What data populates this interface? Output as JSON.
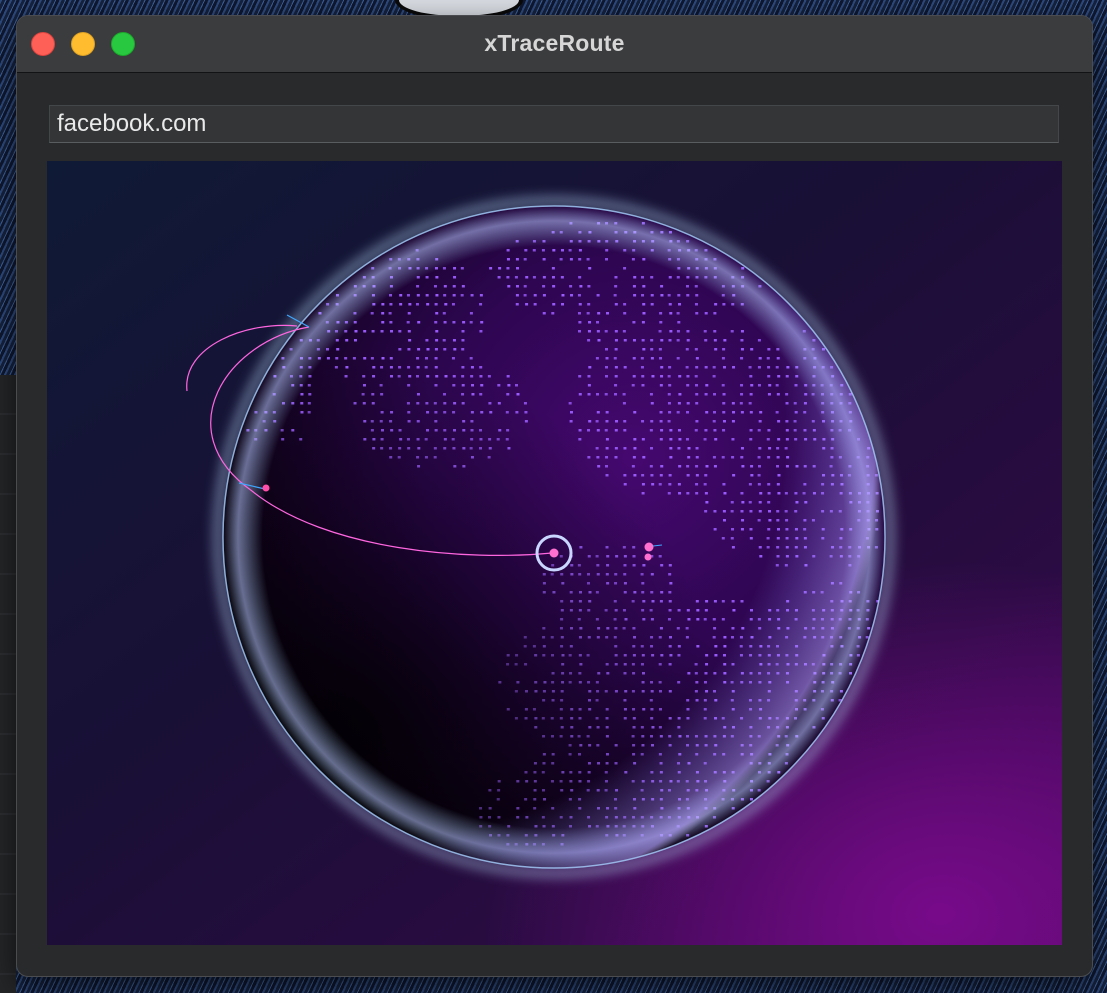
{
  "window": {
    "title": "xTraceRoute"
  },
  "controls": {
    "close": "close-button",
    "minimize": "minimize-button",
    "zoom": "zoom-button"
  },
  "url_input": {
    "value": "facebook.com"
  },
  "colors": {
    "route_line": "#ff66e0",
    "land_dots": "#9b5cff",
    "globe_glow": "#a9d8ff",
    "background_top": "#0f1a36",
    "background_bottom_right": "#6a0a82"
  }
}
